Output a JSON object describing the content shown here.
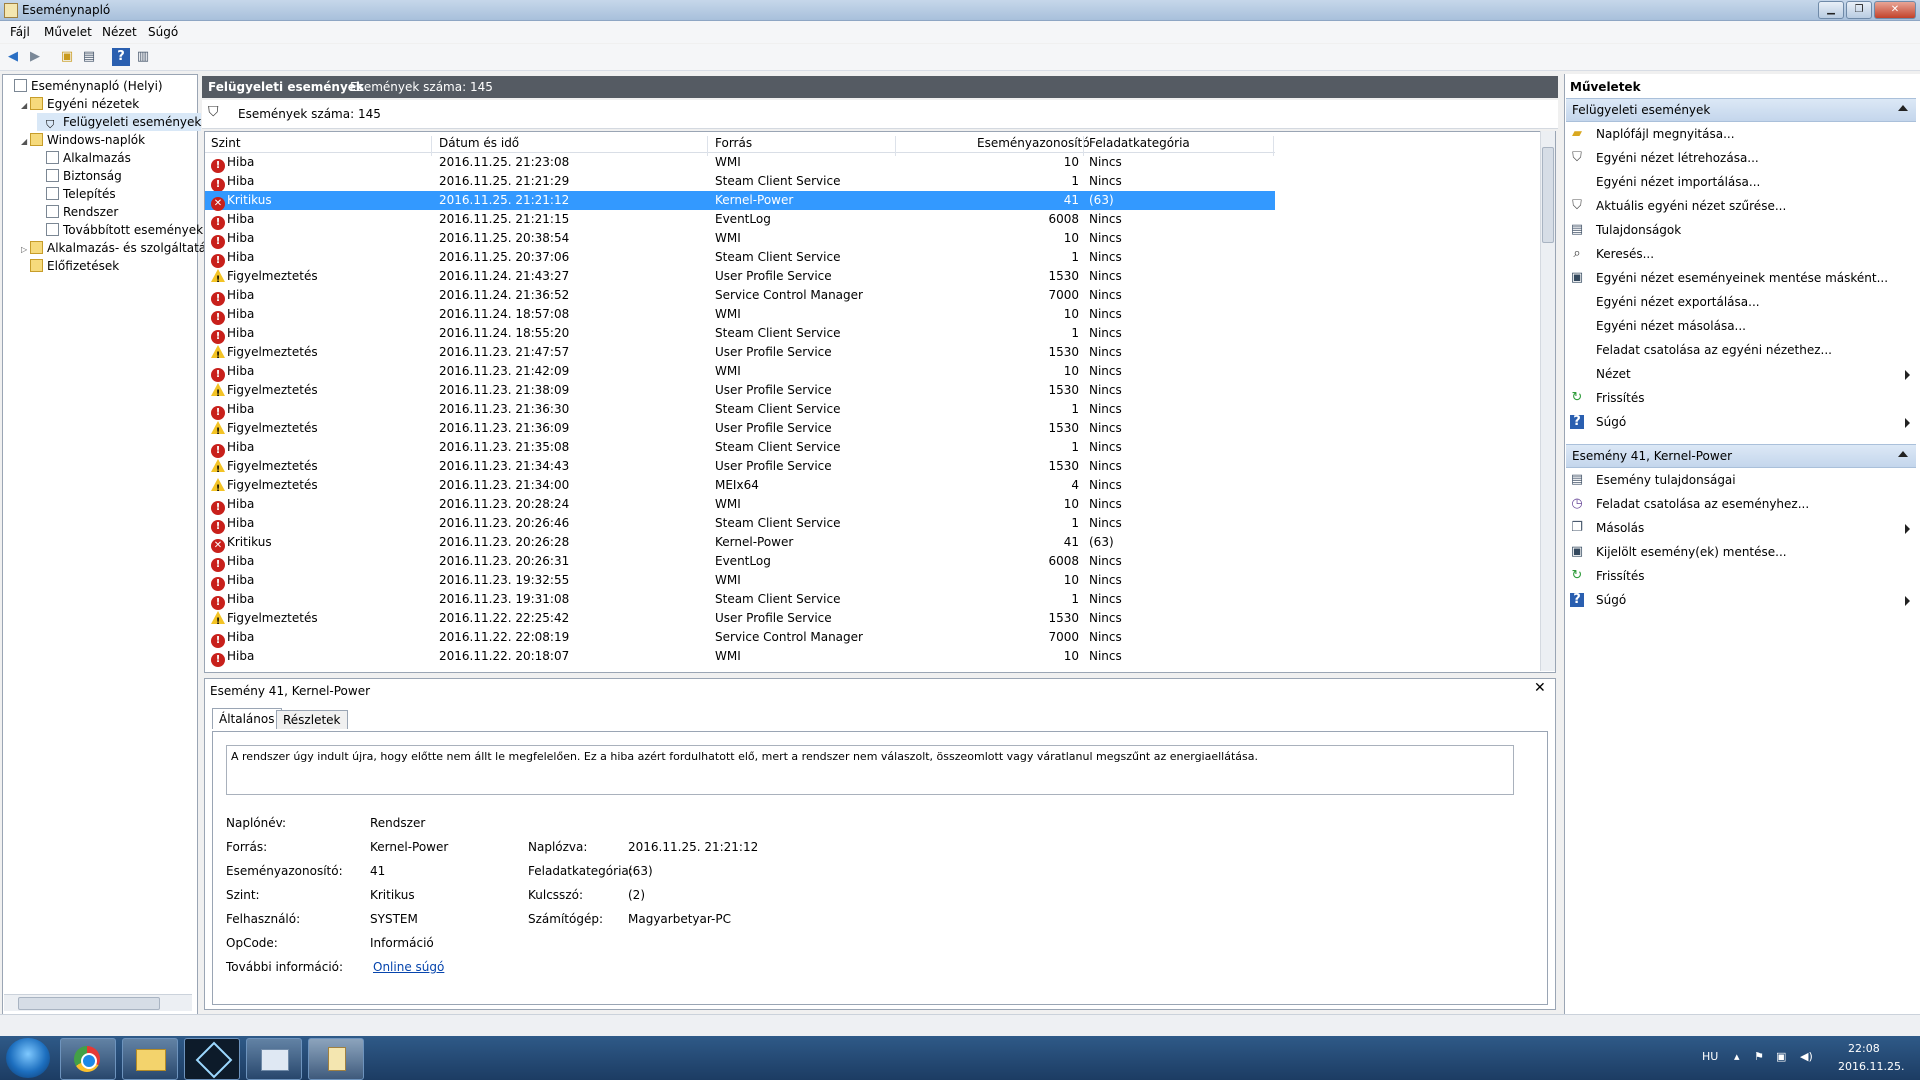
{
  "window": {
    "title": "Eseménynapló"
  },
  "menu": [
    "Fájl",
    "Művelet",
    "Nézet",
    "Súgó"
  ],
  "tree": [
    {
      "label": "Eseménynapló (Helyi)",
      "indent": 0,
      "expander": "",
      "icon": "log"
    },
    {
      "label": "Egyéni nézetek",
      "indent": 1,
      "expander": "◢",
      "icon": "folder"
    },
    {
      "label": "Felügyeleti események",
      "indent": 2,
      "expander": "",
      "icon": "filter",
      "selected": true
    },
    {
      "label": "Windows-naplók",
      "indent": 1,
      "expander": "◢",
      "icon": "folder"
    },
    {
      "label": "Alkalmazás",
      "indent": 2,
      "expander": "",
      "icon": "log"
    },
    {
      "label": "Biztonság",
      "indent": 2,
      "expander": "",
      "icon": "log"
    },
    {
      "label": "Telepítés",
      "indent": 2,
      "expander": "",
      "icon": "log"
    },
    {
      "label": "Rendszer",
      "indent": 2,
      "expander": "",
      "icon": "log"
    },
    {
      "label": "Továbbított események",
      "indent": 2,
      "expander": "",
      "icon": "log"
    },
    {
      "label": "Alkalmazás- és szolgáltatásn",
      "indent": 1,
      "expander": "▷",
      "icon": "folder"
    },
    {
      "label": "Előfizetések",
      "indent": 1,
      "expander": "",
      "icon": "folder"
    }
  ],
  "center": {
    "title": "Felügyeleti események",
    "count_label": "Események száma: 145",
    "filter_label": "Események száma: 145"
  },
  "columns": [
    "Szint",
    "Dátum és idő",
    "Forrás",
    "Eseményazonosító",
    "Feladatkategória"
  ],
  "events": [
    {
      "level": "Hiba",
      "type": "err",
      "date": "2016.11.25. 21:23:08",
      "source": "WMI",
      "id": "10",
      "cat": "Nincs"
    },
    {
      "level": "Hiba",
      "type": "err",
      "date": "2016.11.25. 21:21:29",
      "source": "Steam Client Service",
      "id": "1",
      "cat": "Nincs"
    },
    {
      "level": "Kritikus",
      "type": "crit",
      "date": "2016.11.25. 21:21:12",
      "source": "Kernel-Power",
      "id": "41",
      "cat": "(63)",
      "selected": true
    },
    {
      "level": "Hiba",
      "type": "err",
      "date": "2016.11.25. 21:21:15",
      "source": "EventLog",
      "id": "6008",
      "cat": "Nincs"
    },
    {
      "level": "Hiba",
      "type": "err",
      "date": "2016.11.25. 20:38:54",
      "source": "WMI",
      "id": "10",
      "cat": "Nincs"
    },
    {
      "level": "Hiba",
      "type": "err",
      "date": "2016.11.25. 20:37:06",
      "source": "Steam Client Service",
      "id": "1",
      "cat": "Nincs"
    },
    {
      "level": "Figyelmeztetés",
      "type": "warn",
      "date": "2016.11.24. 21:43:27",
      "source": "User Profile Service",
      "id": "1530",
      "cat": "Nincs"
    },
    {
      "level": "Hiba",
      "type": "err",
      "date": "2016.11.24. 21:36:52",
      "source": "Service Control Manager",
      "id": "7000",
      "cat": "Nincs"
    },
    {
      "level": "Hiba",
      "type": "err",
      "date": "2016.11.24. 18:57:08",
      "source": "WMI",
      "id": "10",
      "cat": "Nincs"
    },
    {
      "level": "Hiba",
      "type": "err",
      "date": "2016.11.24. 18:55:20",
      "source": "Steam Client Service",
      "id": "1",
      "cat": "Nincs"
    },
    {
      "level": "Figyelmeztetés",
      "type": "warn",
      "date": "2016.11.23. 21:47:57",
      "source": "User Profile Service",
      "id": "1530",
      "cat": "Nincs"
    },
    {
      "level": "Hiba",
      "type": "err",
      "date": "2016.11.23. 21:42:09",
      "source": "WMI",
      "id": "10",
      "cat": "Nincs"
    },
    {
      "level": "Figyelmeztetés",
      "type": "warn",
      "date": "2016.11.23. 21:38:09",
      "source": "User Profile Service",
      "id": "1530",
      "cat": "Nincs"
    },
    {
      "level": "Hiba",
      "type": "err",
      "date": "2016.11.23. 21:36:30",
      "source": "Steam Client Service",
      "id": "1",
      "cat": "Nincs"
    },
    {
      "level": "Figyelmeztetés",
      "type": "warn",
      "date": "2016.11.23. 21:36:09",
      "source": "User Profile Service",
      "id": "1530",
      "cat": "Nincs"
    },
    {
      "level": "Hiba",
      "type": "err",
      "date": "2016.11.23. 21:35:08",
      "source": "Steam Client Service",
      "id": "1",
      "cat": "Nincs"
    },
    {
      "level": "Figyelmeztetés",
      "type": "warn",
      "date": "2016.11.23. 21:34:43",
      "source": "User Profile Service",
      "id": "1530",
      "cat": "Nincs"
    },
    {
      "level": "Figyelmeztetés",
      "type": "warn",
      "date": "2016.11.23. 21:34:00",
      "source": "MEIx64",
      "id": "4",
      "cat": "Nincs"
    },
    {
      "level": "Hiba",
      "type": "err",
      "date": "2016.11.23. 20:28:24",
      "source": "WMI",
      "id": "10",
      "cat": "Nincs"
    },
    {
      "level": "Hiba",
      "type": "err",
      "date": "2016.11.23. 20:26:46",
      "source": "Steam Client Service",
      "id": "1",
      "cat": "Nincs"
    },
    {
      "level": "Kritikus",
      "type": "crit",
      "date": "2016.11.23. 20:26:28",
      "source": "Kernel-Power",
      "id": "41",
      "cat": "(63)"
    },
    {
      "level": "Hiba",
      "type": "err",
      "date": "2016.11.23. 20:26:31",
      "source": "EventLog",
      "id": "6008",
      "cat": "Nincs"
    },
    {
      "level": "Hiba",
      "type": "err",
      "date": "2016.11.23. 19:32:55",
      "source": "WMI",
      "id": "10",
      "cat": "Nincs"
    },
    {
      "level": "Hiba",
      "type": "err",
      "date": "2016.11.23. 19:31:08",
      "source": "Steam Client Service",
      "id": "1",
      "cat": "Nincs"
    },
    {
      "level": "Figyelmeztetés",
      "type": "warn",
      "date": "2016.11.22. 22:25:42",
      "source": "User Profile Service",
      "id": "1530",
      "cat": "Nincs"
    },
    {
      "level": "Hiba",
      "type": "err",
      "date": "2016.11.22. 22:08:19",
      "source": "Service Control Manager",
      "id": "7000",
      "cat": "Nincs"
    },
    {
      "level": "Hiba",
      "type": "err",
      "date": "2016.11.22. 20:18:07",
      "source": "WMI",
      "id": "10",
      "cat": "Nincs"
    }
  ],
  "detail": {
    "title": "Esemény 41, Kernel-Power",
    "tabs": [
      "Általános",
      "Részletek"
    ],
    "description": "A rendszer úgy indult újra, hogy előtte nem állt le megfelelően. Ez a hiba azért fordulhatott elő, mert a rendszer nem válaszolt, összeomlott vagy váratlanul megszűnt az energiaellátása.",
    "fields": {
      "log_name_label": "Naplónév:",
      "log_name": "Rendszer",
      "source_label": "Forrás:",
      "source": "Kernel-Power",
      "logged_label": "Naplózva:",
      "logged": "2016.11.25. 21:21:12",
      "event_id_label": "Eseményazonosító:",
      "event_id": "41",
      "task_label": "Feladatkategória:",
      "task": "(63)",
      "level_label": "Szint:",
      "level": "Kritikus",
      "keywords_label": "Kulcsszó:",
      "keywords": "(2)",
      "user_label": "Felhasználó:",
      "user": "SYSTEM",
      "computer_label": "Számítógép:",
      "computer": "Magyarbetyar-PC",
      "opcode_label": "OpCode:",
      "opcode": "Információ",
      "more_label": "További információ:",
      "more_link": "Online súgó"
    }
  },
  "actions": {
    "title": "Műveletek",
    "section1": "Felügyeleti események",
    "items1": [
      {
        "label": "Naplófájl megnyitása...",
        "icon": "open"
      },
      {
        "label": "Egyéni nézet létrehozása...",
        "icon": "filter"
      },
      {
        "label": "Egyéni nézet importálása...",
        "icon": ""
      },
      {
        "label": "Aktuális egyéni nézet szűrése...",
        "icon": "filter"
      },
      {
        "label": "Tulajdonságok",
        "icon": "props"
      },
      {
        "label": "Keresés...",
        "icon": "find"
      },
      {
        "label": "Egyéni nézet eseményeinek mentése másként...",
        "icon": "save"
      },
      {
        "label": "Egyéni nézet exportálása...",
        "icon": ""
      },
      {
        "label": "Egyéni nézet másolása...",
        "icon": ""
      },
      {
        "label": "Feladat csatolása az egyéni nézethez...",
        "icon": ""
      },
      {
        "label": "Nézet",
        "icon": "",
        "submenu": true
      },
      {
        "label": "Frissítés",
        "icon": "refresh"
      },
      {
        "label": "Súgó",
        "icon": "help",
        "submenu": true
      }
    ],
    "section2": "Esemény 41, Kernel-Power",
    "items2": [
      {
        "label": "Esemény tulajdonságai",
        "icon": "props"
      },
      {
        "label": "Feladat csatolása az eseményhez...",
        "icon": "task"
      },
      {
        "label": "Másolás",
        "icon": "copy",
        "submenu": true
      },
      {
        "label": "Kijelölt esemény(ek) mentése...",
        "icon": "save"
      },
      {
        "label": "Frissítés",
        "icon": "refresh"
      },
      {
        "label": "Súgó",
        "icon": "help",
        "submenu": true
      }
    ]
  },
  "taskbar": {
    "lang": "HU",
    "time": "22:08",
    "date": "2016.11.25."
  }
}
